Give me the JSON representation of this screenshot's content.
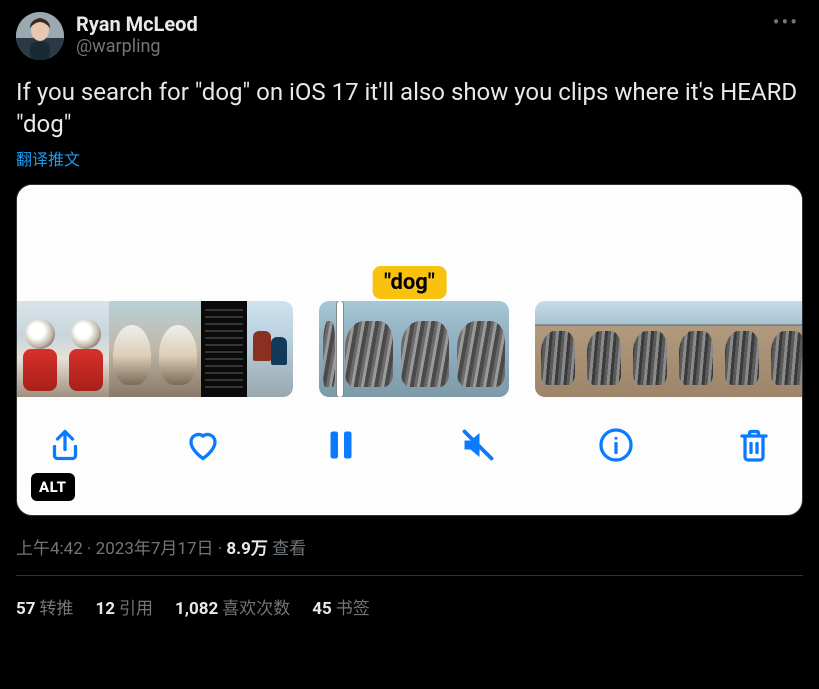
{
  "author": {
    "display_name": "Ryan McLeod",
    "handle": "@warpling"
  },
  "tweet_text": "If you search for \"dog\" on iOS 17 it'll also show you clips where it's HEARD \"dog\"",
  "translate_label": "翻译推文",
  "media": {
    "badge_text": "\"dog\"",
    "alt_badge": "ALT"
  },
  "meta": {
    "time": "上午4:42",
    "date": "2023年7月17日",
    "views_count": "8.9万",
    "views_label": "查看"
  },
  "stats": {
    "retweets_count": "57",
    "retweets_label": "转推",
    "quotes_count": "12",
    "quotes_label": "引用",
    "likes_count": "1,082",
    "likes_label": "喜欢次数",
    "bookmarks_count": "45",
    "bookmarks_label": "书签"
  }
}
